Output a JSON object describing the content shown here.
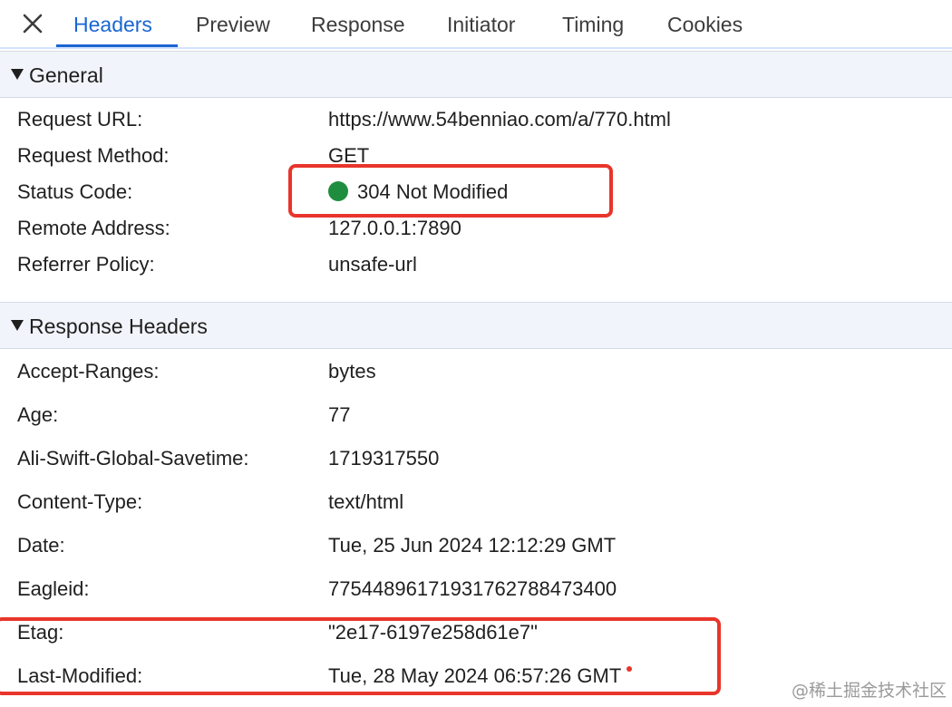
{
  "tabs": {
    "close_icon": "close-icon",
    "items": [
      {
        "label": "Headers",
        "active": true
      },
      {
        "label": "Preview",
        "active": false
      },
      {
        "label": "Response",
        "active": false
      },
      {
        "label": "Initiator",
        "active": false
      },
      {
        "label": "Timing",
        "active": false
      },
      {
        "label": "Cookies",
        "active": false
      }
    ]
  },
  "general": {
    "title": "General",
    "rows": [
      {
        "key": "Request URL:",
        "value": "https://www.54benniao.com/a/770.html"
      },
      {
        "key": "Request Method:",
        "value": "GET"
      },
      {
        "key": "Status Code:",
        "value": "304 Not Modified",
        "status_color": "#1e8e3e"
      },
      {
        "key": "Remote Address:",
        "value": "127.0.0.1:7890"
      },
      {
        "key": "Referrer Policy:",
        "value": "unsafe-url"
      }
    ]
  },
  "response_headers": {
    "title": "Response Headers",
    "rows": [
      {
        "key": "Accept-Ranges:",
        "value": "bytes"
      },
      {
        "key": "Age:",
        "value": "77"
      },
      {
        "key": "Ali-Swift-Global-Savetime:",
        "value": "1719317550"
      },
      {
        "key": "Content-Type:",
        "value": "text/html"
      },
      {
        "key": "Date:",
        "value": "Tue, 25 Jun 2024 12:12:29 GMT"
      },
      {
        "key": "Eagleid:",
        "value": "77544896171931762788473400"
      },
      {
        "key": "Etag:",
        "value": "\"2e17-6197e258d61e7\""
      },
      {
        "key": "Last-Modified:",
        "value": "Tue, 28 May 2024 06:57:26 GMT"
      }
    ]
  },
  "watermark": "@稀土掘金技术社区",
  "colors": {
    "accent": "#1a66d2",
    "annotation": "#e8352b",
    "section_bg": "#f1f4fa"
  }
}
